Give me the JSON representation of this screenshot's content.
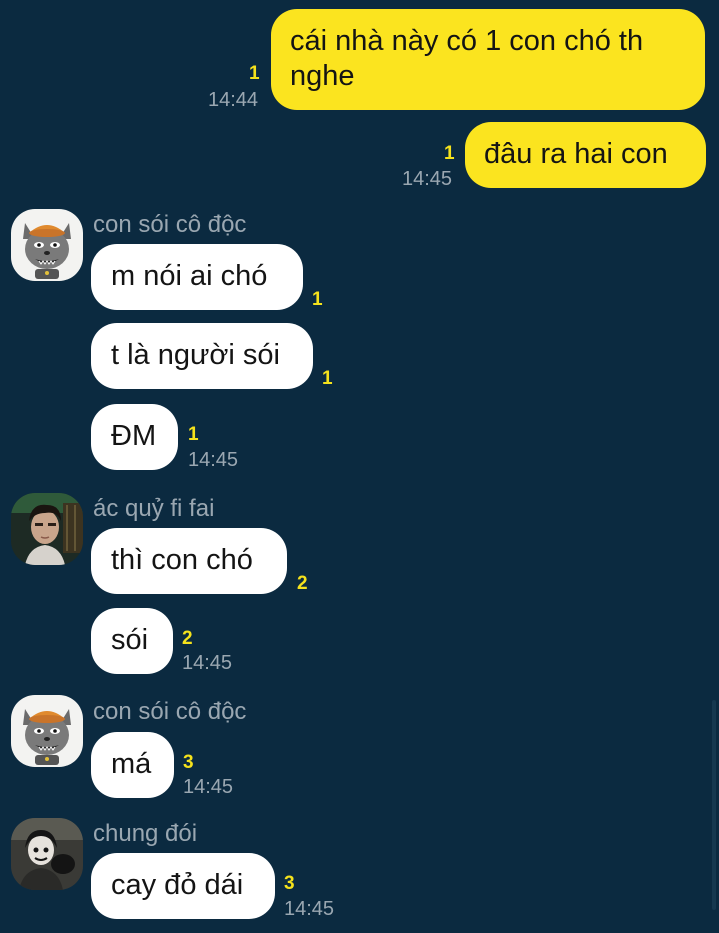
{
  "messages": [
    {
      "id": "m1",
      "text_lines": [
        "cái nhà này có 1 con chó th",
        "nghe"
      ],
      "unread": "1",
      "time": "14:44"
    },
    {
      "id": "m2",
      "text": "đâu ra hai con",
      "unread": "1",
      "time": "14:45"
    },
    {
      "id": "m3",
      "sender": "con sói cô độc",
      "text": "m nói ai chó",
      "unread": "1"
    },
    {
      "id": "m4",
      "text": "t là người sói",
      "unread": "1"
    },
    {
      "id": "m5",
      "text": "ĐM",
      "unread": "1",
      "time": "14:45"
    },
    {
      "id": "m6",
      "sender": "ác quỷ fi fai",
      "text": "thì con chó",
      "unread": "2"
    },
    {
      "id": "m7",
      "text": "sói",
      "unread": "2",
      "time": "14:45"
    },
    {
      "id": "m8",
      "sender": "con sói cô độc",
      "text": "má",
      "unread": "3",
      "time": "14:45"
    },
    {
      "id": "m9",
      "sender": "chung đói",
      "text": "cay đỏ dái",
      "unread": "3",
      "time": "14:45"
    }
  ],
  "colors": {
    "background": "#0b2a40",
    "outgoing_bubble": "#fbe41f",
    "incoming_bubble": "#ffffff",
    "unread_count": "#f5e21c",
    "meta_text": "#9aa7b1"
  },
  "icons": {
    "wolf_avatar": "wolf-avatar-icon",
    "person_avatar": "profile-photo"
  }
}
